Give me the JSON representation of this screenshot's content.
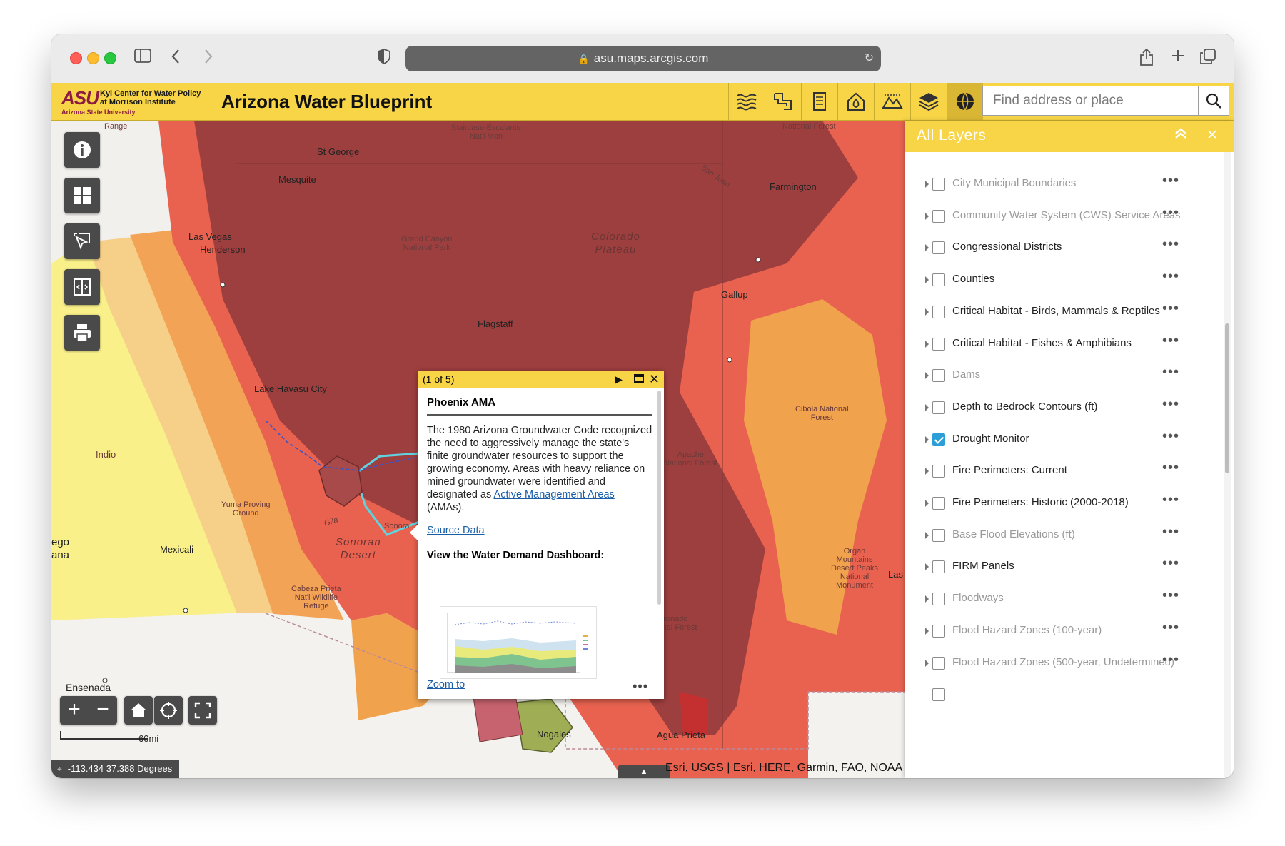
{
  "browser": {
    "url": "asu.maps.arcgis.com",
    "icons": [
      "sidebar-icon",
      "back-icon",
      "forward-icon",
      "shield-icon",
      "lock-icon",
      "reload-icon",
      "share-icon",
      "new-tab-icon",
      "tabs-icon"
    ]
  },
  "header": {
    "logo_asu": "ASU",
    "logo_line1": "Kyl Center for Water Policy",
    "logo_line2": "at Morrison Institute",
    "logo_sub": "Arizona State University",
    "title": "Arizona Water Blueprint",
    "tool_icons": [
      "water-icon",
      "flow-icon",
      "document-icon",
      "home-drop-icon",
      "terrain-icon",
      "layers-icon",
      "basemap-globe-icon"
    ],
    "search_placeholder": "Find address or place"
  },
  "map": {
    "labels": {
      "range": "Range",
      "staircase": "Staircase-Escalante\nNat'l Mon",
      "national_forest_top": "National Forest",
      "st_george": "St George",
      "mesquite": "Mesquite",
      "san_juan": "San Juan",
      "farmington": "Farmington",
      "las_vegas": "Las Vegas",
      "henderson": "Henderson",
      "grand_canyon": "Grand Canyon\nNational Park",
      "colorado_plateau": "Colorado\nPlateau",
      "gallup": "Gallup",
      "flagstaff": "Flagstaff",
      "lake_havasu": "Lake Havasu City",
      "cibola": "Cibola National\nForest",
      "indio": "Indio",
      "apache": "Apache\nNational Forest",
      "yuma": "Yuma Proving\nGround",
      "gila": "Gila",
      "sonoran": "Sonoran\nDesert",
      "sonora": "Sonora",
      "mexicali": "Mexicali",
      "ego": "ego",
      "ana": "ana",
      "cabeza": "Cabeza Prieta\nNat'l Wildlife\nRefuge",
      "organ": "Organ\nMountains\nDesert Peaks\nNational\nMonument",
      "las": "Las",
      "ensenada": "Ensenada",
      "coronado": "Coronado\nNational Forest",
      "nogales": "Nogales",
      "agua_prieta": "Agua Prieta"
    },
    "scale_label": "60mi",
    "coordinates": "-113.434 37.388 Degrees",
    "attribution": "Esri, USGS | Esri, HERE, Garmin, FAO, NOAA",
    "left_tools": [
      "info-icon",
      "grid-icon",
      "select-icon",
      "swipe-icon",
      "print-icon"
    ],
    "nav": {
      "zoom_in": "+",
      "zoom_out": "−"
    }
  },
  "popup": {
    "counter": "(1 of 5)",
    "title": "Phoenix AMA",
    "body_text": "The 1980 Arizona Groundwater Code recognized the need to aggressively manage the state's finite groundwater resources to support the growing economy. Areas with heavy reliance on mined groundwater were identified and designated as ",
    "link_text": "Active Management Areas",
    "body_suffix": " (AMAs).",
    "source_link": "Source Data",
    "dashboard_label": "View the Water Demand Dashboard:",
    "zoom_link": "Zoom to",
    "more": "•••"
  },
  "layers_panel": {
    "title": "All Layers",
    "more": "•••",
    "items": [
      {
        "label": "City Municipal Boundaries",
        "checked": false,
        "dim": true
      },
      {
        "label": "Community Water System (CWS) Service Areas",
        "checked": false,
        "dim": true
      },
      {
        "label": "Congressional Districts",
        "checked": false,
        "dim": false
      },
      {
        "label": "Counties",
        "checked": false,
        "dim": false
      },
      {
        "label": "Critical Habitat - Birds, Mammals & Reptiles",
        "checked": false,
        "dim": false
      },
      {
        "label": "Critical Habitat - Fishes & Amphibians",
        "checked": false,
        "dim": false
      },
      {
        "label": "Dams",
        "checked": false,
        "dim": true
      },
      {
        "label": "Depth to Bedrock Contours (ft)",
        "checked": false,
        "dim": false
      },
      {
        "label": "Drought Monitor",
        "checked": true,
        "dim": false
      },
      {
        "label": "Fire Perimeters: Current",
        "checked": false,
        "dim": false
      },
      {
        "label": "Fire Perimeters: Historic (2000-2018)",
        "checked": false,
        "dim": false
      },
      {
        "label": "Base Flood Elevations (ft)",
        "checked": false,
        "dim": true
      },
      {
        "label": "FIRM Panels",
        "checked": false,
        "dim": false
      },
      {
        "label": "Floodways",
        "checked": false,
        "dim": true
      },
      {
        "label": "Flood Hazard Zones (100-year)",
        "checked": false,
        "dim": true
      },
      {
        "label": "Flood Hazard Zones (500-year, Undetermined)",
        "checked": false,
        "dim": true
      }
    ]
  }
}
